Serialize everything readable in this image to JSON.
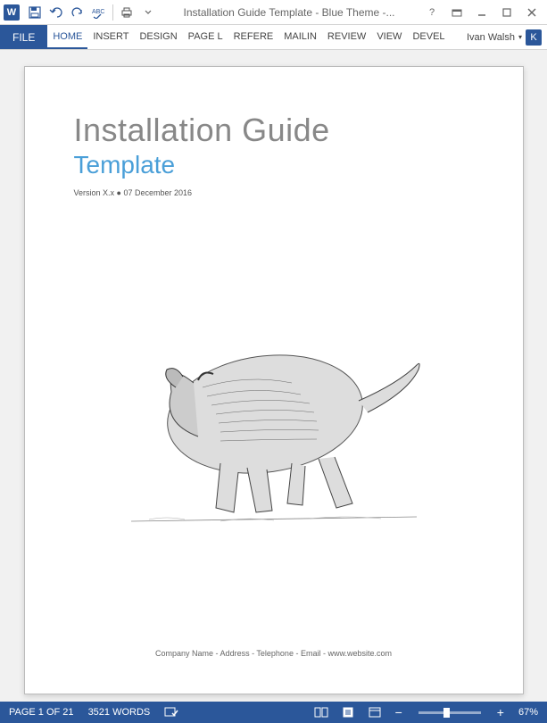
{
  "colors": {
    "accent": "#2b579a",
    "subtitle": "#4a9fd8"
  },
  "qat": {
    "app_letter": "W",
    "title": "Installation Guide Template - Blue Theme -..."
  },
  "ribbon": {
    "file_label": "FILE",
    "tabs": [
      "HOME",
      "INSERT",
      "DESIGN",
      "PAGE L",
      "REFERE",
      "MAILIN",
      "REVIEW",
      "VIEW",
      "DEVEL"
    ],
    "active_tab": "HOME",
    "user_name": "Ivan Walsh",
    "user_initial": "K"
  },
  "document": {
    "title": "Installation Guide",
    "subtitle": "Template",
    "version_line": "Version X.x ● 07 December 2016",
    "footer": "Company Name - Address - Telephone - Email - www.website.com"
  },
  "statusbar": {
    "page_info": "PAGE 1 OF 21",
    "word_count": "3521 WORDS",
    "zoom_label": "67%"
  }
}
